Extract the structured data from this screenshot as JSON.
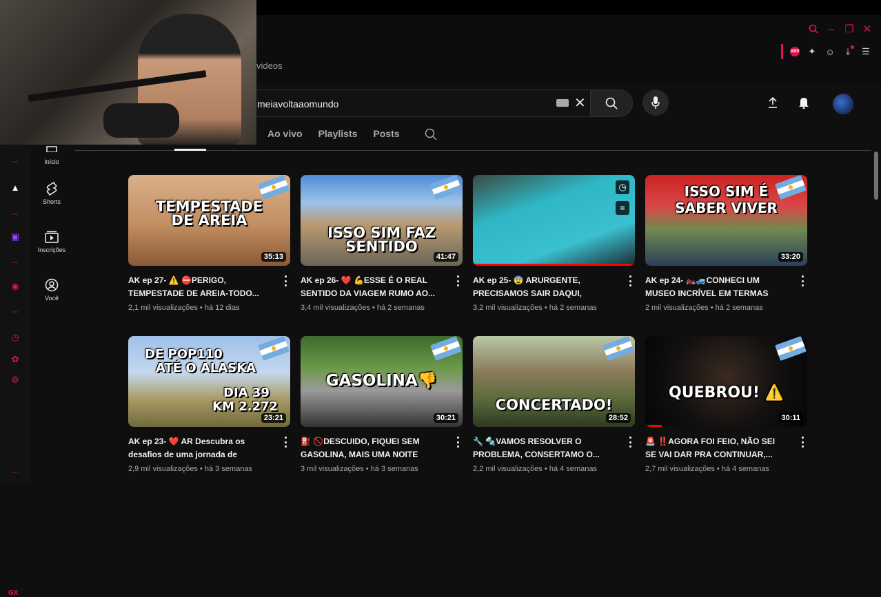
{
  "browser": {
    "tab_title": "videos",
    "extension_badge": "ABP"
  },
  "search": {
    "query": "meiavoltaaomundo"
  },
  "nav": [
    {
      "label": "Início"
    },
    {
      "label": "Shorts"
    },
    {
      "label": "Inscrições"
    },
    {
      "label": "Você"
    }
  ],
  "tabs": [
    "Ao vivo",
    "Playlists",
    "Posts"
  ],
  "sidebar_strip": {
    "gx_label": "GX"
  },
  "videos": [
    {
      "title": "AK ep 27- ⚠️ ⛔PERIGO, TEMPESTADE DE AREIA-TODO...",
      "stats": "2,1 mil visualizações • há 12 dias",
      "duration": "35:13",
      "thumb_text": [
        "TEMPESTADE",
        "DE AREIA"
      ]
    },
    {
      "title": "AK ep 26- ❤️ 💪ESSE É O REAL SENTIDO DA VIAGEM RUMO AO...",
      "stats": "3,4 mil visualizações • há 2 semanas",
      "duration": "41:47",
      "thumb_text": [
        "ISSO SIM FAZ",
        "SENTIDO"
      ]
    },
    {
      "title": "AK ep 25- 😨 ARURGENTE, PRECISAMOS SAIR DAQUI, MUITO...",
      "stats": "3,2 mil visualizações • há 2 semanas",
      "duration": "",
      "thumb_text": []
    },
    {
      "title": "AK ep 24- 🏍️🚙CONHECI UM MUSEO INCRÍVEL EM TERMAS DO...",
      "stats": "2 mil visualizações • há 2 semanas",
      "duration": "33:20",
      "thumb_text": [
        "ISSO SIM É",
        "SABER VIVER"
      ]
    },
    {
      "title": "AK ep 23- ❤️ AR Descubra os desafios de uma jornada de moto...",
      "stats": "2,9 mil visualizações • há 3 semanas",
      "duration": "23:21",
      "thumb_text": [
        "DE POP110",
        "ATÉ O ALASKA",
        "DIA 39",
        "KM 2.272"
      ]
    },
    {
      "title": "⛽ 🚫DESCUIDO, FIQUEI SEM GASOLINA, MAIS UMA NOITE DE...",
      "stats": "3 mil visualizações • há 3 semanas",
      "duration": "30:21",
      "thumb_text": [
        "GASOLINA👎"
      ]
    },
    {
      "title": "🔧 🔩VAMOS RESOLVER O PROBLEMA, CONSERTAMO O...",
      "stats": "2,2 mil visualizações • há 4 semanas",
      "duration": "28:52",
      "thumb_text": [
        "CONCERTADO!"
      ]
    },
    {
      "title": "🚨 ‼️AGORA FOI FEIO, NÃO SEI SE VAI DAR PRA CONTINUAR,...",
      "stats": "2,7 mil visualizações • há 4 semanas",
      "duration": "30:11",
      "thumb_text": [
        "QUEBROU! ⚠️"
      ]
    }
  ],
  "colors": {
    "accent": "#e0144c",
    "youtube_red": "#ff0000",
    "background": "#0f0f0f"
  }
}
